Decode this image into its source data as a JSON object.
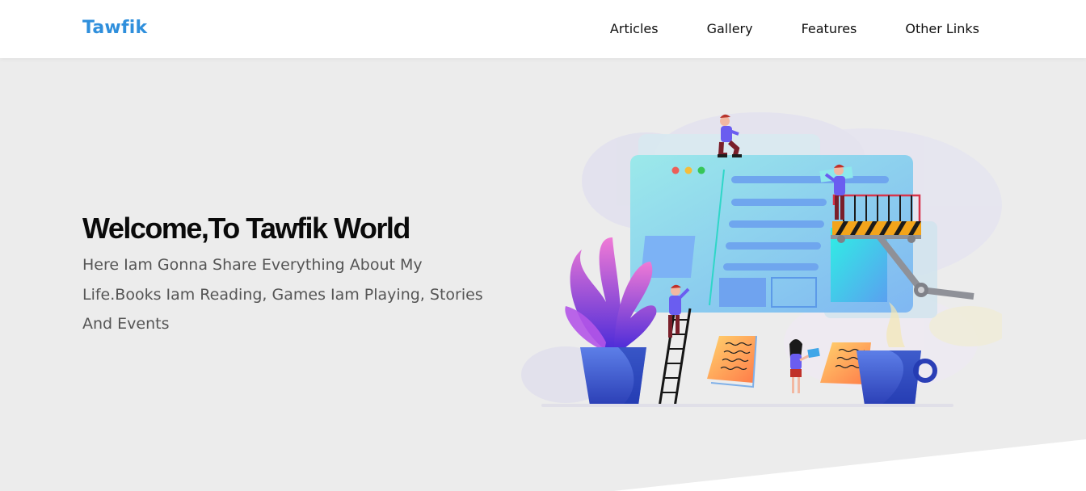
{
  "header": {
    "logo": "Tawfik",
    "nav": [
      {
        "label": "Articles"
      },
      {
        "label": "Gallery"
      },
      {
        "label": "Features"
      },
      {
        "label": "Other Links"
      }
    ]
  },
  "hero": {
    "title": "Welcome,To Tawfik World",
    "text": "Here Iam Gonna Share Everything About My Life.Books Iam Reading, Games Iam Playing, Stories And Events"
  },
  "colors": {
    "brand": "#2f8fdc",
    "hero_bg": "#ececec",
    "header_bg": "#ffffff"
  }
}
